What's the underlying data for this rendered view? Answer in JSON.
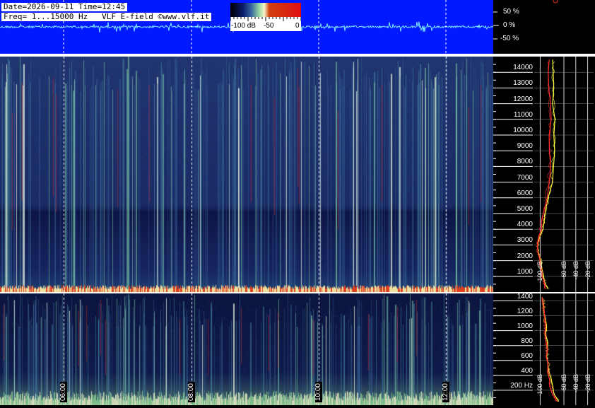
{
  "header": {
    "line1": "Date=2026-09-11 Time=12:45",
    "line2": "Freq= 1...15000 Hz   VLF E-field ©www.vlf.it"
  },
  "colorbar": {
    "labels": [
      "-100 dB",
      "-50",
      "0"
    ],
    "colors": [
      "#000000",
      "#0a1a6a",
      "#3a6aa0",
      "#8fd0a0",
      "#f4f4c8",
      "#d04010",
      "#e01010"
    ]
  },
  "scope": {
    "labels": [
      "50 %",
      "0 %",
      "-50 %"
    ],
    "values": [
      50,
      0,
      -50
    ],
    "background": "#0019ff",
    "trace_color": "#7fe8ff"
  },
  "chart_data": [
    {
      "type": "heatmap",
      "name": "main-spectrogram",
      "title": "",
      "xlabel": "",
      "ylabel": "",
      "ylim": [
        0,
        15000
      ],
      "ytick_values": [
        1000,
        2000,
        3000,
        4000,
        5000,
        6000,
        7000,
        8000,
        9000,
        10000,
        11000,
        12000,
        13000,
        14000
      ],
      "ytick_labels": [
        "1000",
        "2000",
        "3000",
        "4000",
        "5000",
        "6000",
        "7000",
        "8000",
        "9000",
        "10000",
        "11000",
        "12000",
        "13000",
        "14000"
      ],
      "colorscale": "dB",
      "background": "#17225c",
      "grid": true
    },
    {
      "type": "heatmap",
      "name": "low-spectrogram",
      "title": "",
      "xlabel": "",
      "ylabel": "",
      "ylim": [
        0,
        1500
      ],
      "ytick_values": [
        200,
        400,
        600,
        800,
        1000,
        1200,
        1400
      ],
      "ytick_labels": [
        "200 Hz",
        "400",
        "600",
        "800",
        "1000",
        "1200",
        "1400"
      ],
      "x_time_labels": [
        "06:00",
        "08:00",
        "10:00",
        "12:00"
      ],
      "background": "#0d1540",
      "grid": true
    },
    {
      "type": "line",
      "name": "main-spectrum",
      "title": "",
      "xlabel": "",
      "ylabel": "",
      "x_unit": "dB",
      "xtick_labels": [
        "-100 dB",
        "-60 dB",
        "-40 dB",
        "-20 dB"
      ],
      "xlim": [
        -110,
        -10
      ],
      "series": [
        {
          "color": "#ffff40",
          "freq": [
            200,
            600,
            1000,
            1500,
            2000,
            2500,
            3000,
            3500,
            4000,
            4500,
            5000,
            6000,
            7000,
            8000,
            9000,
            10000,
            11000,
            12000,
            13000,
            14000,
            14800
          ],
          "db": [
            -88,
            -92,
            -95,
            -97,
            -99,
            -103,
            -104,
            -101,
            -97,
            -94,
            -91,
            -86,
            -81,
            -79,
            -77,
            -76,
            -76,
            -77,
            -78,
            -78,
            -77
          ]
        },
        {
          "color": "#ff3030",
          "freq": [
            200,
            600,
            1000,
            1500,
            2000,
            2500,
            3000,
            3500,
            4000,
            4500,
            5000,
            6000,
            7000,
            8000,
            9000,
            10000,
            11000,
            12000,
            13000,
            14000,
            14800
          ],
          "db": [
            -90,
            -94,
            -97,
            -99,
            -101,
            -104,
            -105,
            -102,
            -99,
            -96,
            -93,
            -89,
            -86,
            -84,
            -83,
            -83,
            -83,
            -84,
            -85,
            -86,
            -86
          ]
        }
      ]
    },
    {
      "type": "line",
      "name": "low-spectrum",
      "title": "",
      "xlabel": "",
      "ylabel": "",
      "x_unit": "dB",
      "xtick_labels": [
        "-100 dB",
        "-60 dB",
        "-40 dB",
        "-20 dB"
      ],
      "xlim": [
        -110,
        -10
      ],
      "series": [
        {
          "color": "#ffff40",
          "freq": [
            50,
            150,
            250,
            350,
            450,
            550,
            650,
            750,
            850,
            950,
            1050,
            1150,
            1250,
            1350,
            1450
          ],
          "db": [
            -70,
            -76,
            -80,
            -83,
            -85,
            -86,
            -87,
            -88,
            -89,
            -90,
            -91,
            -92,
            -93,
            -94,
            -95
          ]
        },
        {
          "color": "#ff3030",
          "freq": [
            50,
            150,
            250,
            350,
            450,
            550,
            650,
            750,
            850,
            950,
            1050,
            1150,
            1250,
            1350,
            1450
          ],
          "db": [
            -72,
            -78,
            -82,
            -84,
            -86,
            -87,
            -88,
            -89,
            -90,
            -91,
            -92,
            -93,
            -94,
            -95,
            -96
          ]
        }
      ]
    }
  ]
}
